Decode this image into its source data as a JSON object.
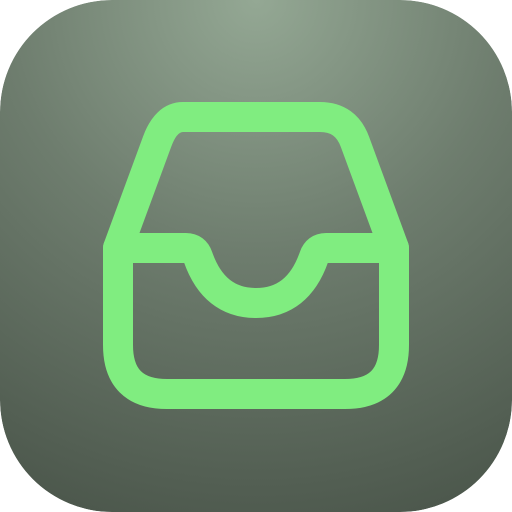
{
  "icon": {
    "name": "inbox-tray-icon",
    "stroke_color": "#80ED80",
    "background_top_color": "#94A894",
    "background_mid_color": "#6E7D6E",
    "background_bottom_color": "#4A554A"
  }
}
